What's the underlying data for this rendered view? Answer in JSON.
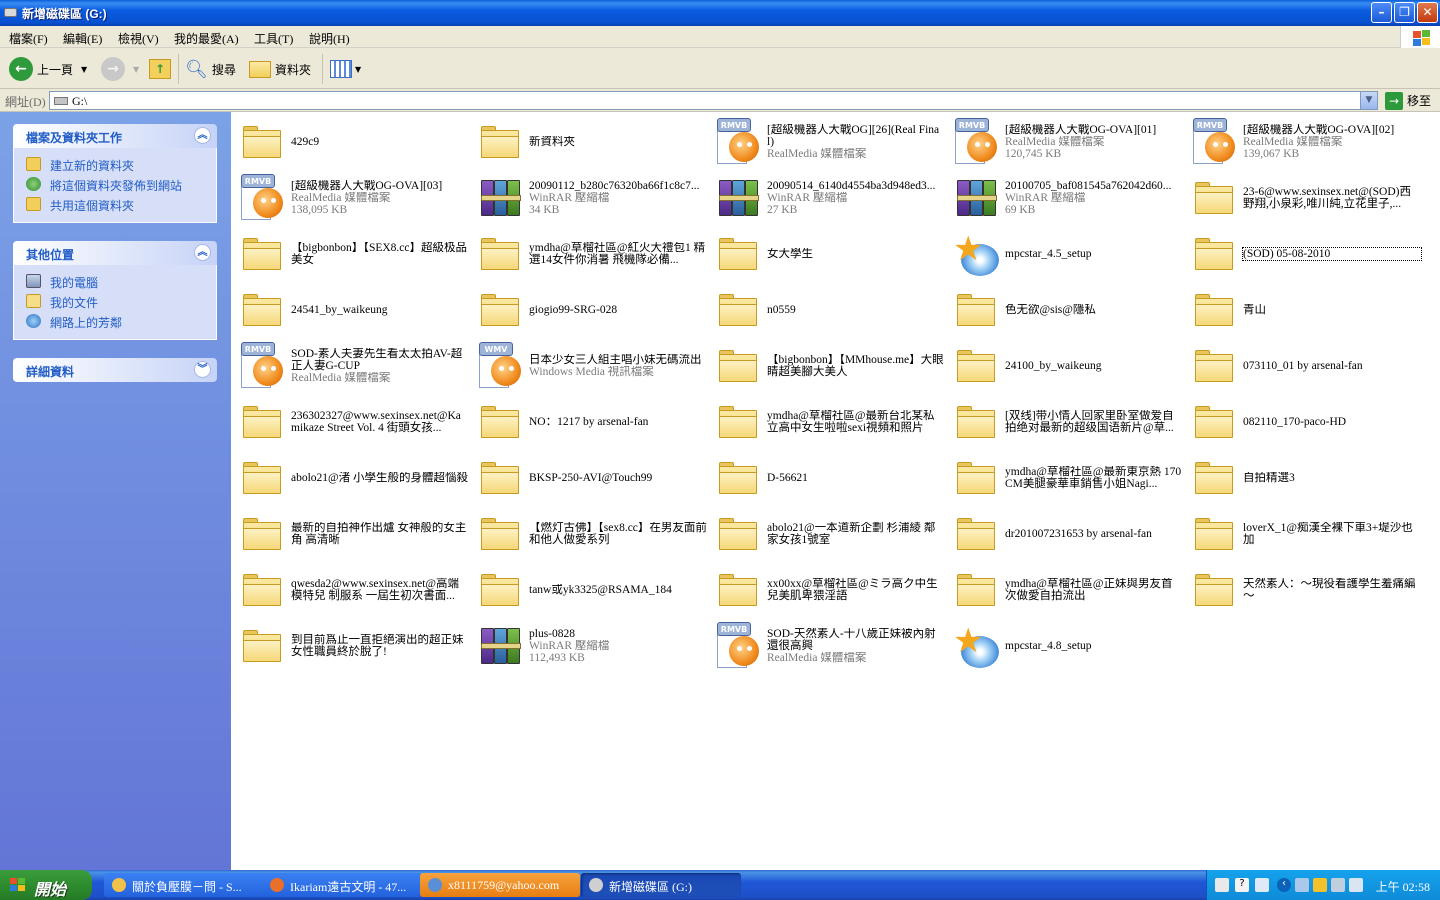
{
  "window": {
    "title": "新增磁碟區 (G:)"
  },
  "menu": [
    "檔案(F)",
    "編輯(E)",
    "檢視(V)",
    "我的最愛(A)",
    "工具(T)",
    "說明(H)"
  ],
  "toolbar": {
    "back": "上一頁",
    "search": "搜尋",
    "folders": "資料夾"
  },
  "address": {
    "label": "網址(D)",
    "value": "G:\\",
    "go": "移至"
  },
  "sidebar": {
    "tasks": {
      "title": "檔案及資料夾工作",
      "items": [
        "建立新的資料夾",
        "將這個資料夾發佈到網站",
        "共用這個資料夾"
      ]
    },
    "places": {
      "title": "其他位置",
      "items": [
        "我的電腦",
        "我的文件",
        "網路上的芳鄰"
      ]
    },
    "details": {
      "title": "詳細資料"
    }
  },
  "files": [
    {
      "name": "429c9",
      "type": "folder"
    },
    {
      "name": "新資料夾",
      "type": "folder"
    },
    {
      "name": "[超級機器人大戰OG][26](Real Final)",
      "type": "rmvb",
      "sub": "RealMedia 媒體檔案"
    },
    {
      "name": "[超級機器人大戰OG-OVA][01]",
      "type": "rmvb",
      "sub": "RealMedia 媒體檔案",
      "size": "120,745 KB"
    },
    {
      "name": "[超級機器人大戰OG-OVA][02]",
      "type": "rmvb",
      "sub": "RealMedia 媒體檔案",
      "size": "139,067 KB"
    },
    {
      "name": "[超級機器人大戰OG-OVA][03]",
      "type": "rmvb",
      "sub": "RealMedia 媒體檔案",
      "size": "138,095 KB"
    },
    {
      "name": "20090112_b280c76320ba66f1c8c7...",
      "type": "rar",
      "sub": "WinRAR 壓縮檔",
      "size": "34 KB"
    },
    {
      "name": "20090514_6140d4554ba3d948ed3...",
      "type": "rar",
      "sub": "WinRAR 壓縮檔",
      "size": "27 KB"
    },
    {
      "name": "20100705_baf081545a762042d60...",
      "type": "rar",
      "sub": "WinRAR 壓縮檔",
      "size": "69 KB"
    },
    {
      "name": "23-6@www.sexinsex.net@(SOD)西野翔,小泉彩,唯川純,立花里子,...",
      "type": "folder"
    },
    {
      "name": "【bigbonbon】【SEX8.cc】超級极品美女",
      "type": "folder"
    },
    {
      "name": "ymdha@草榴社區@紅火大禮包1 精選14女件你消暑 飛機隊必備...",
      "type": "folder"
    },
    {
      "name": "女大學生",
      "type": "folder"
    },
    {
      "name": "mpcstar_4.5_setup",
      "type": "star"
    },
    {
      "name": "(SOD) 05-08-2010",
      "type": "folder",
      "selected": true
    },
    {
      "name": "24541_by_waikeung",
      "type": "folder"
    },
    {
      "name": "giogio99-SRG-028",
      "type": "folder"
    },
    {
      "name": "n0559",
      "type": "folder"
    },
    {
      "name": "色无欲@sis@隱私",
      "type": "folder"
    },
    {
      "name": "青山",
      "type": "folder"
    },
    {
      "name": "SOD-素人夫妻先生看太太拍AV-超正人妻G-CUP",
      "type": "rmvb",
      "sub": "RealMedia 媒體檔案"
    },
    {
      "name": "日本少女三人組主唱小妹无碼流出",
      "type": "wmv",
      "sub": "Windows Media 視訊檔案"
    },
    {
      "name": "【bigbonbon】【MMhouse.me】大眼睛超美腳大美人",
      "type": "folder"
    },
    {
      "name": "24100_by_waikeung",
      "type": "folder"
    },
    {
      "name": "073110_01 by arsenal-fan",
      "type": "folder"
    },
    {
      "name": "236302327@www.sexinsex.net@Kamikaze Street Vol. 4 街頭女孩...",
      "type": "folder"
    },
    {
      "name": "NO：1217 by arsenal-fan",
      "type": "folder"
    },
    {
      "name": "ymdha@草榴社區@最新台北某私立高中女生啦啦sexi視頻和照片",
      "type": "folder"
    },
    {
      "name": "[双线]带小情人回家里卧室做爱自拍绝对最新的超级国语新片@草...",
      "type": "folder"
    },
    {
      "name": "082110_170-paco-HD",
      "type": "folder"
    },
    {
      "name": "abolo21@渚 小學生般的身體超惱殺",
      "type": "folder"
    },
    {
      "name": "BKSP-250-AVI@Touch99",
      "type": "folder"
    },
    {
      "name": "D-56621",
      "type": "folder"
    },
    {
      "name": "ymdha@草榴社區@最新東京熱 170CM美腿豪華車銷售小姐Nagi...",
      "type": "folder"
    },
    {
      "name": "自拍精選3",
      "type": "folder"
    },
    {
      "name": "最新的自拍神作出爐 女神般的女主角 高清晰",
      "type": "folder"
    },
    {
      "name": "【燃灯古佛】【sex8.cc】在男友面前和他人做愛系列",
      "type": "folder"
    },
    {
      "name": "abolo21@一本道新企劃 杉浦綾 鄰家女孩1號室",
      "type": "folder"
    },
    {
      "name": "dr201007231653 by arsenal-fan",
      "type": "folder"
    },
    {
      "name": "loverX_1@痴漢全裸下車3+堤沙也加",
      "type": "folder"
    },
    {
      "name": "qwesda2@www.sexinsex.net@高端模特兒 制服系 一屆生初次書面...",
      "type": "folder"
    },
    {
      "name": "tanw或yk3325@RSAMA_184",
      "type": "folder"
    },
    {
      "name": "xx00xx@草榴社區@ミラ高ク中生兒美肌卑猥淫語",
      "type": "folder"
    },
    {
      "name": "ymdha@草榴社區@正妹與男友首次做愛自拍流出",
      "type": "folder"
    },
    {
      "name": "天然素人：～現役看護學生羞痛編～",
      "type": "folder"
    },
    {
      "name": "到目前爲止一直拒絕演出的超正妹女性職員終於脫了!",
      "type": "folder"
    },
    {
      "name": "plus-0828",
      "type": "rar",
      "sub": "WinRAR 壓縮檔",
      "size": "112,493 KB"
    },
    {
      "name": "SOD-天然素人-十八歲正妹被內射還很高興",
      "type": "rmvb",
      "sub": "RealMedia 媒體檔案"
    },
    {
      "name": "mpcstar_4.8_setup",
      "type": "star"
    }
  ],
  "taskbar": {
    "start": "開始",
    "tasks": [
      {
        "label": "關於負壓膜－問 - S...",
        "state": "normal"
      },
      {
        "label": "Ikariam遠古文明 - 47...",
        "state": "normal"
      },
      {
        "label": "x8111759@yahoo.com",
        "state": "flash"
      },
      {
        "label": "新增磁碟區 (G:)",
        "state": "active"
      }
    ],
    "clock": "上午 02:58"
  },
  "colors": {
    "titlebar": "#0a5fd6",
    "sidebar": "#7ba2e7",
    "taskbar": "#245edb",
    "start": "#2e8d2e",
    "link": "#215dc6"
  }
}
